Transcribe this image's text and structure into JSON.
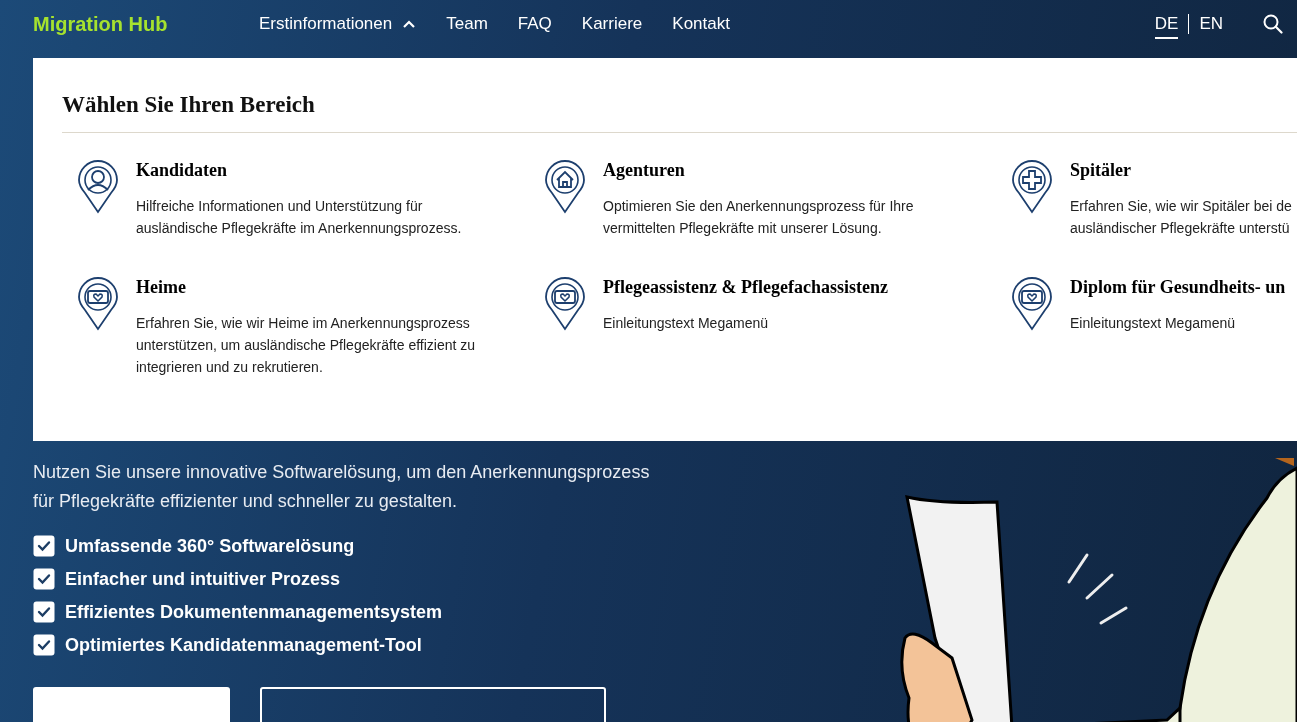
{
  "header": {
    "logo": "Migration Hub",
    "nav": [
      {
        "label": "Erstinformationen",
        "kind": "menu",
        "expanded": true
      },
      {
        "label": "Team",
        "kind": "link"
      },
      {
        "label": "FAQ",
        "kind": "link"
      },
      {
        "label": "Karriere",
        "kind": "link"
      },
      {
        "label": "Kontakt",
        "kind": "link"
      }
    ],
    "languages": [
      {
        "label": "DE",
        "selected": true
      },
      {
        "label": "EN",
        "selected": false
      }
    ]
  },
  "mega_menu": {
    "title": "Wählen Sie Ihren Bereich",
    "items": [
      {
        "kind": "person",
        "title": "Kandidaten",
        "description_lines": [
          "Hilfreiche Informationen und Unterstützung für",
          "ausländische Pflegekräfte im Anerkennungsprozess."
        ]
      },
      {
        "kind": "house",
        "title": "Agenturen",
        "description_lines": [
          "Optimieren Sie den Anerkennungsprozess für Ihre",
          "vermittelten Pflegekräfte mit unserer Lösung."
        ]
      },
      {
        "kind": "cross",
        "title": "Spitäler",
        "description_lines": [
          "Erfahren Sie, wie wir Spitäler bei de",
          "ausländischer Pflegekräfte unterstü"
        ]
      },
      {
        "kind": "heart",
        "title": "Heime",
        "description_lines": [
          "Erfahren Sie, wie wir Heime im Anerkennungsprozess",
          "unterstützen, um ausländische Pflegekräfte effizient zu",
          "integrieren und zu rekrutieren."
        ]
      },
      {
        "kind": "heart",
        "title": "Pflegeassistenz & Pflegefachassistenz",
        "description_lines": [
          "Einleitungstext Megamenü"
        ]
      },
      {
        "kind": "heart",
        "title": "Diplom für Gesundheits- un",
        "description_lines": [
          "Einleitungstext Megamenü"
        ]
      }
    ]
  },
  "hero": {
    "intro": "Nutzen Sie unsere innovative Softwarelösung, um den Anerkennungsprozess für Pflegekräfte effizienter und schneller zu gestalten.",
    "features": [
      {
        "label": "Umfassende 360° Softwarelösung",
        "checked": true
      },
      {
        "label": "Einfacher und intuitiver Prozess",
        "checked": true
      },
      {
        "label": "Effizientes Dokumentenmanagementsystem",
        "checked": true
      },
      {
        "label": "Optimiertes Kandidatenmanagement-Tool",
        "checked": true
      }
    ]
  }
}
